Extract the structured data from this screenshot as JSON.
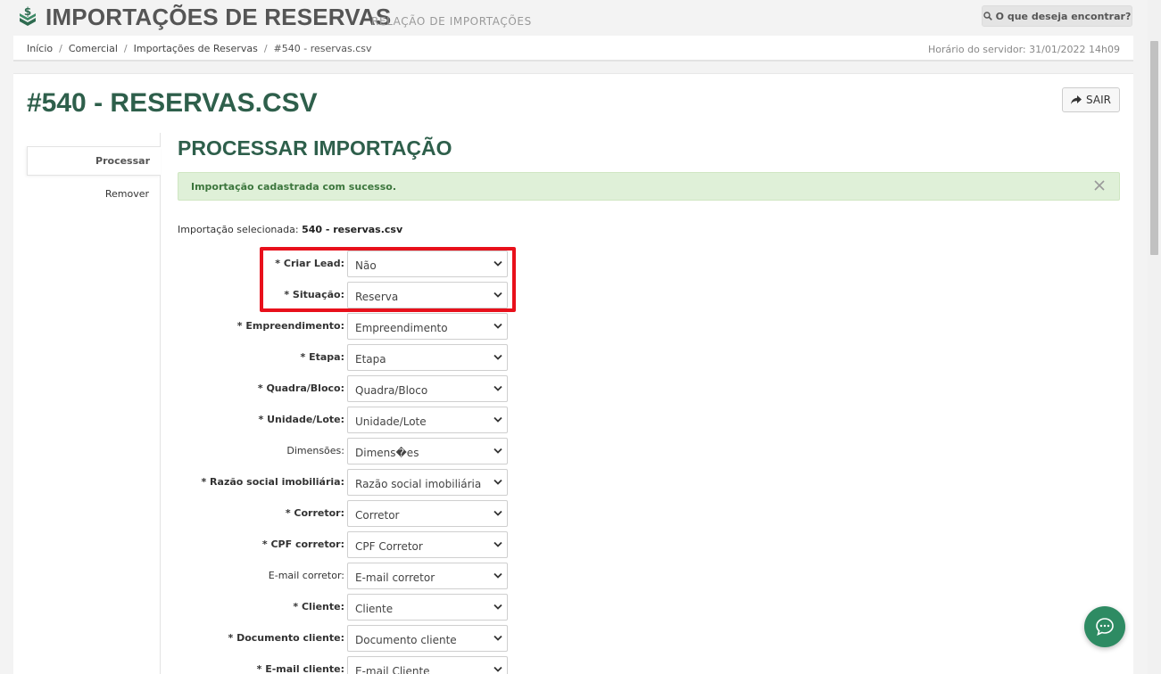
{
  "header": {
    "title": "IMPORTAÇÕES DE RESERVAS",
    "subtitle": "RELAÇÃO DE IMPORTAÇÕES",
    "search_label": "O que deseja encontrar?"
  },
  "breadcrumb": [
    "Início",
    "Comercial",
    "Importações de Reservas",
    "#540 - reservas.csv"
  ],
  "server_time": "Horário do servidor: 31/01/2022 14h09",
  "page": {
    "title": "#540 - RESERVAS.CSV",
    "exit_label": "SAIR"
  },
  "side_menu": [
    {
      "label": "Processar",
      "active": true
    },
    {
      "label": "Remover",
      "active": false
    }
  ],
  "section_title": "PROCESSAR IMPORTAÇÃO",
  "alert": {
    "text": "Importação cadastrada com sucesso."
  },
  "selected": {
    "label": "Importação selecionada:",
    "value": "540 - reservas.csv"
  },
  "form": [
    {
      "label": "* Criar Lead:",
      "value": "Não",
      "required": true
    },
    {
      "label": "* Situação:",
      "value": "Reserva",
      "required": true
    },
    {
      "label": "* Empreendimento:",
      "value": "Empreendimento",
      "required": true
    },
    {
      "label": "* Etapa:",
      "value": "Etapa",
      "required": true
    },
    {
      "label": "* Quadra/Bloco:",
      "value": "Quadra/Bloco",
      "required": true
    },
    {
      "label": "* Unidade/Lote:",
      "value": "Unidade/Lote",
      "required": true
    },
    {
      "label": "Dimensões:",
      "value": "Dimens�es",
      "required": false
    },
    {
      "label": "* Razão social imobiliária:",
      "value": "Razão social imobiliária",
      "required": true
    },
    {
      "label": "* Corretor:",
      "value": "Corretor",
      "required": true
    },
    {
      "label": "* CPF corretor:",
      "value": "CPF Corretor",
      "required": true
    },
    {
      "label": "E-mail corretor:",
      "value": "E-mail corretor",
      "required": false
    },
    {
      "label": "* Cliente:",
      "value": "Cliente",
      "required": true
    },
    {
      "label": "* Documento cliente:",
      "value": "Documento cliente",
      "required": true
    },
    {
      "label": "* E-mail cliente:",
      "value": "E-mail Cliente",
      "required": true
    }
  ],
  "colors": {
    "brand": "#2e5f4b",
    "highlight": "#e8101b",
    "alert_bg": "#dff0d8",
    "chat": "#2e8b63"
  }
}
